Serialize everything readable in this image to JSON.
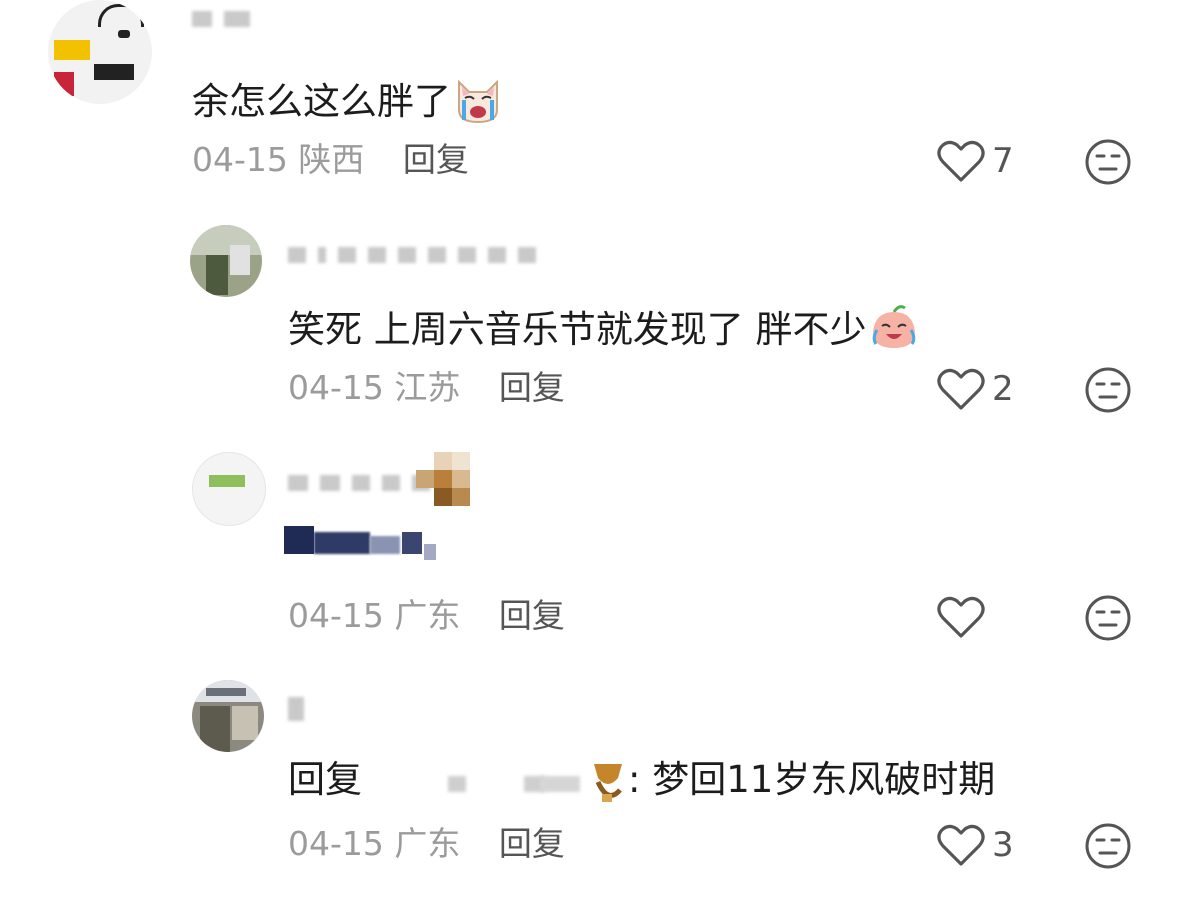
{
  "comments": [
    {
      "text": "余怎么这么胖了",
      "date": "04-15",
      "location": "陕西",
      "reply_label": "回复",
      "likes": "7",
      "emoji": "crying-cat-icon"
    },
    {
      "text": "笑死 上周六音乐节就发现了 胖不少",
      "date": "04-15",
      "location": "江苏",
      "reply_label": "回复",
      "likes": "2",
      "emoji": "laughing-peach-icon"
    },
    {
      "text": "",
      "date": "04-15",
      "location": "广东",
      "reply_label": "回复",
      "likes": ""
    },
    {
      "reply_prefix": "回复",
      "text": ": 梦回11岁东风破时期",
      "date": "04-15",
      "location": "广东",
      "reply_label": "回复",
      "likes": "3"
    }
  ],
  "colors": {
    "meta_gray": "#9b9b9b",
    "text": "#1c1c1c",
    "icon": "#555555"
  }
}
